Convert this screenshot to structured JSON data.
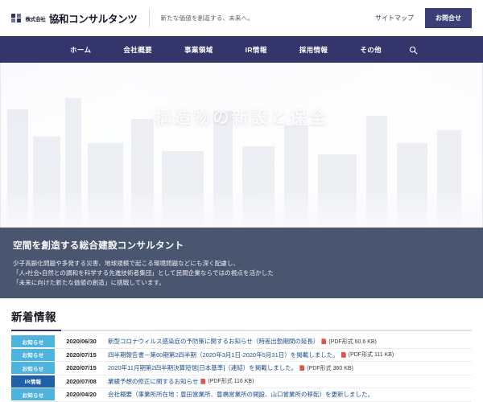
{
  "header": {
    "logo": {
      "prefix": "株式会社",
      "name": "協和コンサルタンツ",
      "mark_icon": "company-square-logo-icon"
    },
    "tagline": "新たな価値を創造する、未来へ。",
    "sitemap_label": "サイトマップ",
    "contact_label": "お問合せ"
  },
  "nav": {
    "items": [
      {
        "label": "ホーム"
      },
      {
        "label": "会社概要"
      },
      {
        "label": "事業領域"
      },
      {
        "label": "IR情報"
      },
      {
        "label": "採用情報"
      },
      {
        "label": "その他"
      }
    ],
    "search_icon": "search-icon"
  },
  "hero": {
    "title": "構造物の新設と保全"
  },
  "intro": {
    "heading": "空間を創造する総合建設コンサルタント",
    "lines": [
      "少子高齢化問題や多発する災害、地球規模で起こる環境問題などにも深く配慮し、",
      "「人・社会・自然との調和を科学する先進技術者集団」として民間企業ならではの視点を活かした",
      "「未来に向けた新たな価値の創造」に挑戦しています。"
    ]
  },
  "news": {
    "heading": "新着情報",
    "rows": [
      {
        "badge": "お知らせ",
        "badge_type": "notice",
        "date": "2020/06/30",
        "text": "新型コロナウィルス感染症の予防策に関するお知らせ（時差出勤期間の延長）",
        "pdf_icon": "pdf-icon",
        "pdf_meta": "(PDF形式 60.6 KB)"
      },
      {
        "badge": "お知らせ",
        "badge_type": "notice",
        "date": "2020/07/15",
        "text": "四半期報告書－第60期第2四半期（2020年3月1日-2020年5月31日）を掲載しました。",
        "pdf_icon": "pdf-icon",
        "pdf_meta": "(PDF形式 111 KB)"
      },
      {
        "badge": "お知らせ",
        "badge_type": "notice",
        "date": "2020/07/15",
        "text": "2020年11月期第2四半期決算短信[日本基準]（連結）を掲載しました。",
        "pdf_icon": "pdf-icon",
        "pdf_meta": "(PDF形式 360 KB)"
      },
      {
        "badge": "IR情報",
        "badge_type": "ir",
        "date": "2020/07/08",
        "text": "業績予想の修正に関するお知らせ",
        "pdf_icon": "pdf-icon",
        "pdf_meta": "(PDF形式 116 KB)"
      },
      {
        "badge": "お知らせ",
        "badge_type": "notice",
        "date": "2020/04/20",
        "text": "会社概要（事業所所在地：豊田営業所、豊橋営業所の開設、山口営業所の移転）を更新しました。",
        "pdf_icon": "",
        "pdf_meta": ""
      }
    ]
  },
  "colors": {
    "nav_bg": "#33356b",
    "accent": "#3b3f78",
    "intro_bg": "#4a5570",
    "badge_notice": "#4fb4dd",
    "badge_ir": "#1f5fa8",
    "link": "#1c4f8f"
  }
}
